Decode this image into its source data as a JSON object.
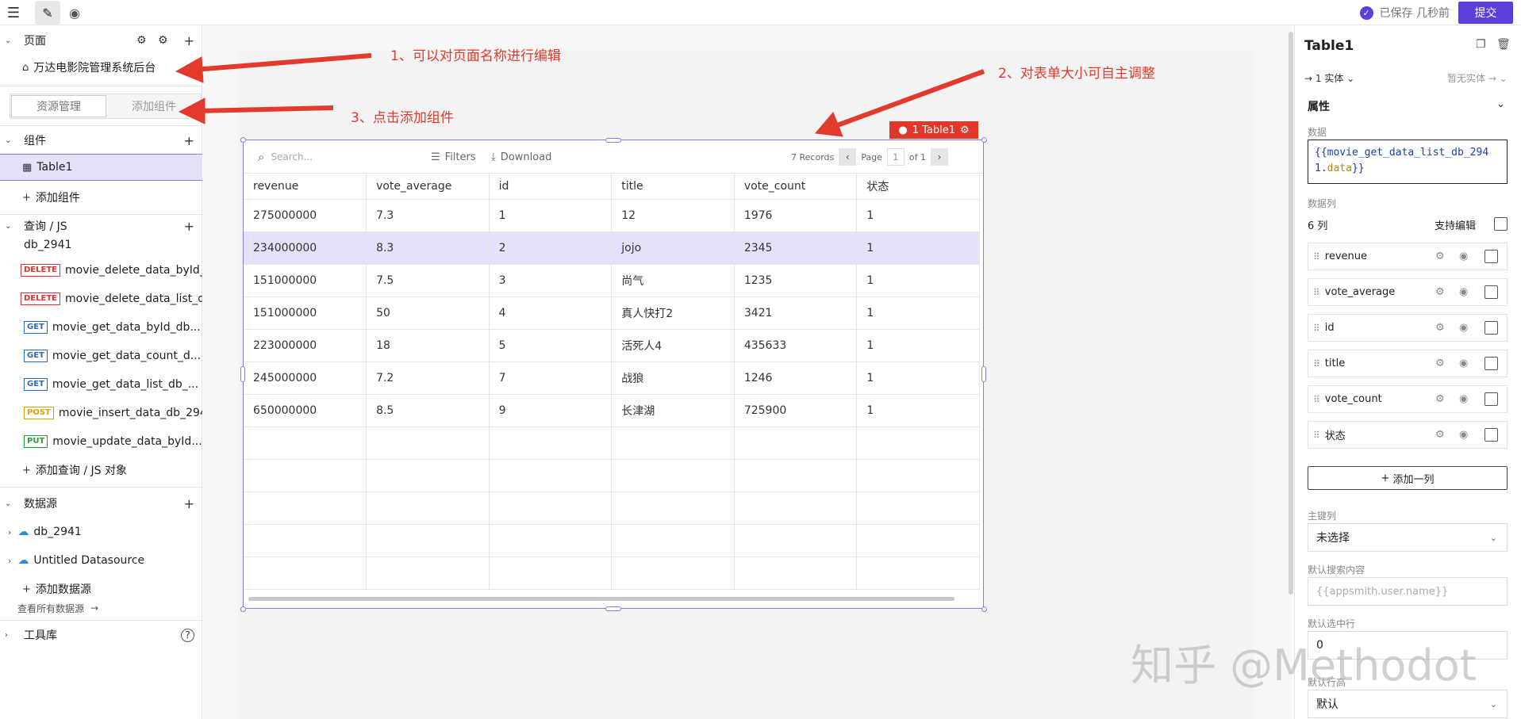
{
  "topbar": {
    "save_status": "已保存 几秒前",
    "submit": "提交"
  },
  "left": {
    "pages_title": "页面",
    "page_name": "万达电影院管理系统后台",
    "tabs": [
      "资源管理",
      "添加组件"
    ],
    "widgets_title": "组件",
    "widget_table": "Table1",
    "add_widget": "添加组件",
    "query_title": "查询 / JS",
    "db_group": "db_2941",
    "queries": [
      {
        "method": "DELETE",
        "name": "movie_delete_data_byId_..."
      },
      {
        "method": "DELETE",
        "name": "movie_delete_data_list_d..."
      },
      {
        "method": "GET",
        "name": "movie_get_data_byId_db..."
      },
      {
        "method": "GET",
        "name": "movie_get_data_count_d..."
      },
      {
        "method": "GET",
        "name": "movie_get_data_list_db_..."
      },
      {
        "method": "POST",
        "name": "movie_insert_data_db_2941"
      },
      {
        "method": "PUT",
        "name": "movie_update_data_byId..."
      }
    ],
    "add_query": "添加查询 / JS 对象",
    "datasource_title": "数据源",
    "datasources": [
      "db_2941",
      "Untitled Datasource"
    ],
    "add_datasource": "添加数据源",
    "view_all": "查看所有数据源",
    "toolkit": "工具库"
  },
  "annotations": {
    "a1": "1、可以对页面名称进行编辑",
    "a2": "2、对表单大小可自主调整",
    "a3": "3、点击添加组件"
  },
  "widget_label": "1  Table1",
  "table": {
    "search_placeholder": "Search...",
    "filters": "Filters",
    "download": "Download",
    "records": "7 Records",
    "page_label": "Page",
    "page_num": "1",
    "of_label": "of 1",
    "columns": [
      "revenue",
      "vote_average",
      "id",
      "title",
      "vote_count",
      "状态"
    ],
    "rows": [
      [
        "275000000",
        "7.3",
        "1",
        "12",
        "1976",
        "1"
      ],
      [
        "234000000",
        "8.3",
        "2",
        "jojo",
        "2345",
        "1"
      ],
      [
        "151000000",
        "7.5",
        "3",
        "尚气",
        "1235",
        "1"
      ],
      [
        "151000000",
        "50",
        "4",
        "真人快打2",
        "3421",
        "1"
      ],
      [
        "223000000",
        "18",
        "5",
        "活死人4",
        "435633",
        "1"
      ],
      [
        "245000000",
        "7.2",
        "7",
        "战狼",
        "1246",
        "1"
      ],
      [
        "650000000",
        "8.5",
        "9",
        "长津湖",
        "725900",
        "1"
      ]
    ],
    "highlighted_row": 1
  },
  "right": {
    "title": "Table1",
    "entity": "1 实体",
    "no_entity": "暂无实体",
    "props_title": "属性",
    "data_label": "数据",
    "data_value_a": "{{movie_get_data_list_db_2941.",
    "data_value_b": "data",
    "data_value_c": "}}",
    "columns_label": "数据列",
    "columns_count": "6 列",
    "support_edit": "支持编辑",
    "column_items": [
      "revenue",
      "vote_average",
      "id",
      "title",
      "vote_count",
      "状态"
    ],
    "add_column": "添加一列",
    "primary_label": "主键列",
    "primary_value": "未选择",
    "default_search_label": "默认搜索内容",
    "default_search_placeholder": "{{appsmith.user.name}}",
    "default_row_label": "默认选中行",
    "default_row_value": "0",
    "default_height_label": "默认行高",
    "default_height_value": "默认"
  },
  "watermark": "知乎 @Methodot"
}
